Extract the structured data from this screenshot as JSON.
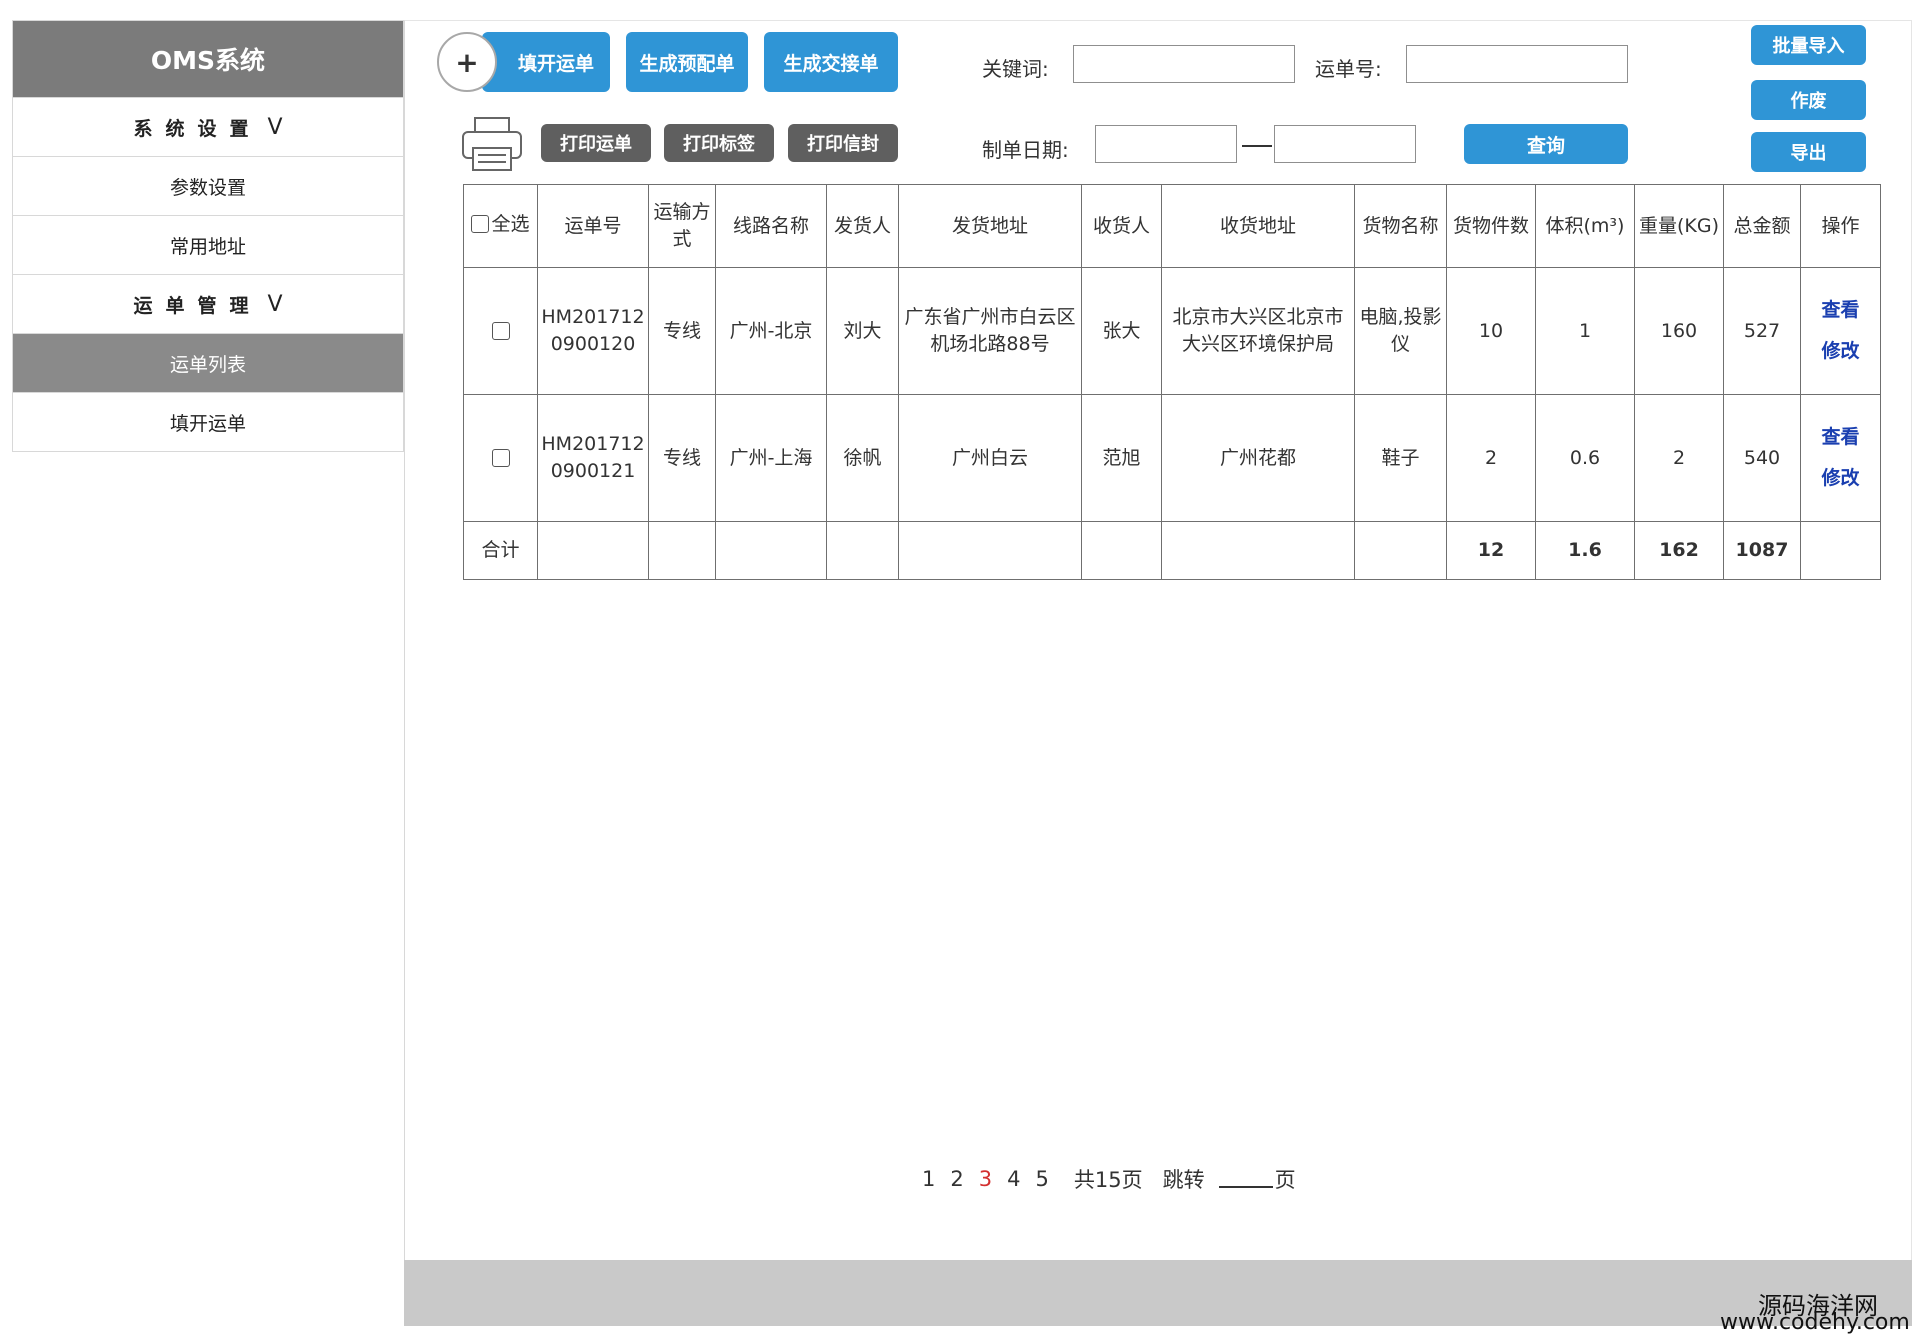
{
  "sidebar": {
    "title": "OMS系统",
    "groups": [
      {
        "label": "系统设置",
        "chevron": "V",
        "items": [
          "参数设置",
          "常用地址"
        ]
      },
      {
        "label": "运单管理",
        "chevron": "V",
        "items": [
          "运单列表",
          "填开运单"
        ]
      }
    ],
    "active_item": "运单列表"
  },
  "toolbar": {
    "add_symbol": "+",
    "fill_waybill": "填开运单",
    "gen_preassign": "生成预配单",
    "gen_handover": "生成交接单",
    "print_waybill": "打印运单",
    "print_label": "打印标签",
    "print_envelope": "打印信封",
    "batch_import": "批量导入",
    "void": "作废",
    "export": "导出",
    "query": "查询"
  },
  "search": {
    "keyword_label": "关键词:",
    "keyword_value": "",
    "waybill_label": "运单号:",
    "waybill_value": "",
    "date_label": "制单日期:",
    "date_from": "",
    "date_to": ""
  },
  "table": {
    "select_all": "全选",
    "headers": [
      "运单号",
      "运输方式",
      "线路名称",
      "发货人",
      "发货地址",
      "收货人",
      "收货地址",
      "货物名称",
      "货物件数",
      "体积(m³)",
      "重量(KG)",
      "总金额",
      "操作"
    ],
    "rows": [
      {
        "waybill": "HM2017120900120",
        "transport": "专线",
        "route": "广州-北京",
        "shipper": "刘大",
        "ship_addr": "广东省广州市白云区机场北路88号",
        "consignee": "张大",
        "recv_addr": "北京市大兴区北京市大兴区环境保护局",
        "goods": "电脑,投影仪",
        "pieces": "10",
        "volume": "1",
        "weight": "160",
        "amount": "527",
        "view": "查看",
        "edit": "修改"
      },
      {
        "waybill": "HM2017120900121",
        "transport": "专线",
        "route": "广州-上海",
        "shipper": "徐帆",
        "ship_addr": "广州白云",
        "consignee": "范旭",
        "recv_addr": "广州花都",
        "goods": "鞋子",
        "pieces": "2",
        "volume": "0.6",
        "weight": "2",
        "amount": "540",
        "view": "查看",
        "edit": "修改"
      }
    ],
    "summary": {
      "label": "合计",
      "pieces": "12",
      "volume": "1.6",
      "weight": "162",
      "amount": "1087"
    }
  },
  "pagination": {
    "pages": [
      "1",
      "2",
      "3",
      "4",
      "5"
    ],
    "current": "3",
    "total": "共15页",
    "jump": "跳转",
    "page_suffix": "页"
  },
  "watermark": {
    "line1": "源码海洋网",
    "line2": "www.codehy.com"
  },
  "colors": {
    "primary_blue": "#2f95d6",
    "dark_button": "#5f5f5f",
    "sidebar_header": "#7b7b7b",
    "link_blue": "#1a3fb0",
    "current_page": "#d32f2f"
  }
}
